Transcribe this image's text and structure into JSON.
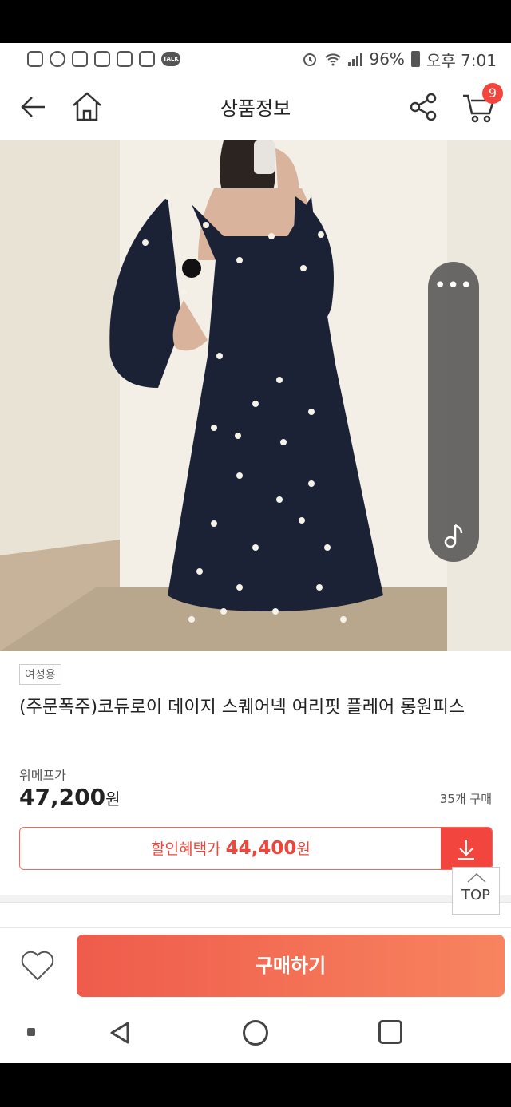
{
  "status_bar": {
    "left_icons": [
      "gallery-icon",
      "shield-icon",
      "app-icon",
      "instagram-icon",
      "instagram-icon",
      "instagram-icon",
      "kakaotalk-icon"
    ],
    "talk_label": "TALK",
    "battery": "96%",
    "time": "오후 7:01"
  },
  "header": {
    "title": "상품정보",
    "cart_count": "9"
  },
  "floating_panel": {
    "more_label": "•••"
  },
  "product": {
    "category": "여성용",
    "title": "(주문폭주)코듀로이 데이지 스퀘어넥 여리핏 플레어 롱원피스",
    "price_label": "위메프가",
    "price": "47,200",
    "price_unit": "원",
    "purchase_count": "35개 구매",
    "discount_label": "할인혜택가",
    "discount_price": "44,400",
    "discount_unit": "원"
  },
  "top_button": {
    "label": "TOP"
  },
  "bottom_bar": {
    "buy_label": "구매하기"
  },
  "colors": {
    "accent": "#f2453d",
    "buy_gradient_start": "#ef5b4b",
    "buy_gradient_end": "#f7845f",
    "dress": "#1c2236"
  }
}
